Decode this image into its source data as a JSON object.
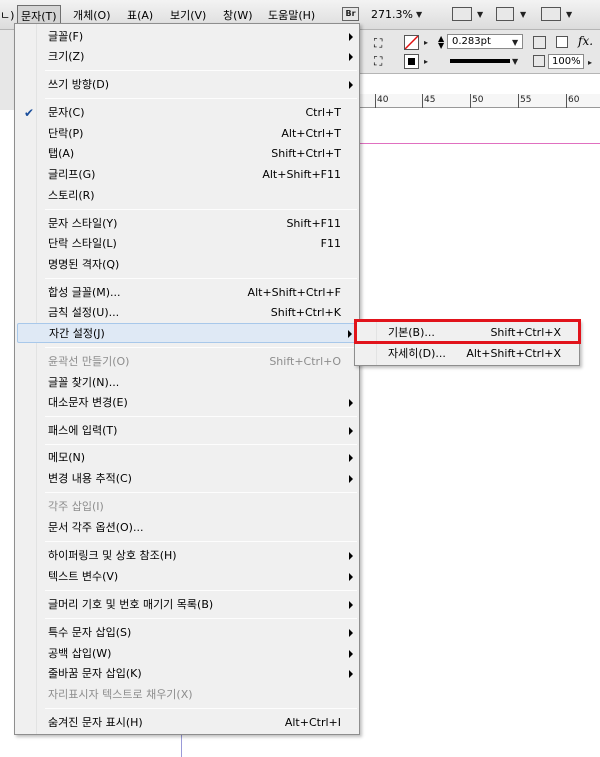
{
  "menubar": {
    "items": [
      "ㄴ)",
      "문자(T)",
      "개체(O)",
      "표(A)",
      "보기(V)",
      "창(W)",
      "도움말(H)"
    ],
    "bridge_label": "Br",
    "zoom": "271.3%"
  },
  "control_bar": {
    "stroke_weight": "0.283pt",
    "opacity": "100%"
  },
  "ruler": {
    "ticks": [
      "40",
      "45",
      "50",
      "55",
      "60"
    ]
  },
  "menu": {
    "items": [
      {
        "label": "글꼴(F)",
        "shortcut": "",
        "submenu": true
      },
      {
        "label": "크기(Z)",
        "shortcut": "",
        "submenu": true
      },
      {
        "label": "쓰기 방향(D)",
        "shortcut": "",
        "submenu": true
      },
      {
        "label": "문자(C)",
        "shortcut": "Ctrl+T",
        "checked": true
      },
      {
        "label": "단락(P)",
        "shortcut": "Alt+Ctrl+T"
      },
      {
        "label": "탭(A)",
        "shortcut": "Shift+Ctrl+T"
      },
      {
        "label": "글리프(G)",
        "shortcut": "Alt+Shift+F11"
      },
      {
        "label": "스토리(R)",
        "shortcut": ""
      },
      {
        "label": "문자 스타일(Y)",
        "shortcut": "Shift+F11"
      },
      {
        "label": "단락 스타일(L)",
        "shortcut": "F11"
      },
      {
        "label": "명명된 격자(Q)",
        "shortcut": ""
      },
      {
        "label": "합성 글꼴(M)...",
        "shortcut": "Alt+Shift+Ctrl+F"
      },
      {
        "label": "금칙 설정(U)...",
        "shortcut": "Shift+Ctrl+K"
      },
      {
        "label": "자간 설정(J)",
        "shortcut": "",
        "submenu": true,
        "highlighted": true
      },
      {
        "label": "윤곽선 만들기(O)",
        "shortcut": "Shift+Ctrl+O",
        "disabled": true
      },
      {
        "label": "글꼴 찾기(N)...",
        "shortcut": ""
      },
      {
        "label": "대소문자 변경(E)",
        "shortcut": "",
        "submenu": true
      },
      {
        "label": "패스에 입력(T)",
        "shortcut": "",
        "submenu": true
      },
      {
        "label": "메모(N)",
        "shortcut": "",
        "submenu": true
      },
      {
        "label": "변경 내용 추적(C)",
        "shortcut": "",
        "submenu": true
      },
      {
        "label": "각주 삽입(I)",
        "shortcut": "",
        "disabled": true
      },
      {
        "label": "문서 각주 옵션(O)...",
        "shortcut": ""
      },
      {
        "label": "하이퍼링크 및 상호 참조(H)",
        "shortcut": "",
        "submenu": true
      },
      {
        "label": "텍스트 변수(V)",
        "shortcut": "",
        "submenu": true
      },
      {
        "label": "글머리 기호 및 번호 매기기 목록(B)",
        "shortcut": "",
        "submenu": true
      },
      {
        "label": "특수 문자 삽입(S)",
        "shortcut": "",
        "submenu": true
      },
      {
        "label": "공백 삽입(W)",
        "shortcut": "",
        "submenu": true
      },
      {
        "label": "줄바꿈 문자 삽입(K)",
        "shortcut": "",
        "submenu": true
      },
      {
        "label": "자리표시자 텍스트로 채우기(X)",
        "shortcut": "",
        "disabled": true
      },
      {
        "label": "숨겨진 문자 표시(H)",
        "shortcut": "Alt+Ctrl+I"
      }
    ]
  },
  "submenu": {
    "items": [
      {
        "label": "기본(B)...",
        "shortcut": "Shift+Ctrl+X"
      },
      {
        "label": "자세히(D)...",
        "shortcut": "Alt+Shift+Ctrl+X"
      }
    ]
  }
}
